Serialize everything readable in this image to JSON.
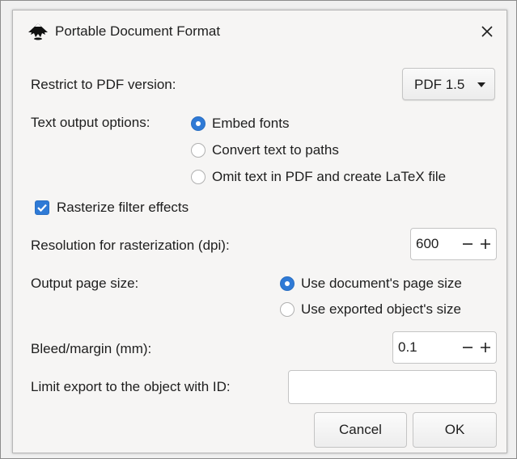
{
  "title": "Portable Document Format",
  "icons": {
    "app": "inkscape-logo-icon",
    "close": "close-icon"
  },
  "pdf_version": {
    "label": "Restrict to PDF version:",
    "selected": "PDF 1.5"
  },
  "text_output": {
    "label": "Text output options:",
    "options": [
      {
        "label": "Embed fonts",
        "selected": true
      },
      {
        "label": "Convert text to paths",
        "selected": false
      },
      {
        "label": "Omit text in PDF and create LaTeX file",
        "selected": false
      }
    ]
  },
  "rasterize": {
    "label": "Rasterize filter effects",
    "checked": true
  },
  "resolution": {
    "label": "Resolution for rasterization (dpi):",
    "value": "600"
  },
  "page_size": {
    "label": "Output page size:",
    "options": [
      {
        "label": "Use document's page size",
        "selected": true
      },
      {
        "label": "Use exported object's size",
        "selected": false
      }
    ]
  },
  "bleed": {
    "label": "Bleed/margin (mm):",
    "value": "0.1"
  },
  "limit_export": {
    "label": "Limit export to the object with ID:",
    "value": ""
  },
  "buttons": {
    "cancel": "Cancel",
    "ok": "OK"
  },
  "colors": {
    "accent": "#2f7ad6",
    "background": "#f6f5f4"
  }
}
